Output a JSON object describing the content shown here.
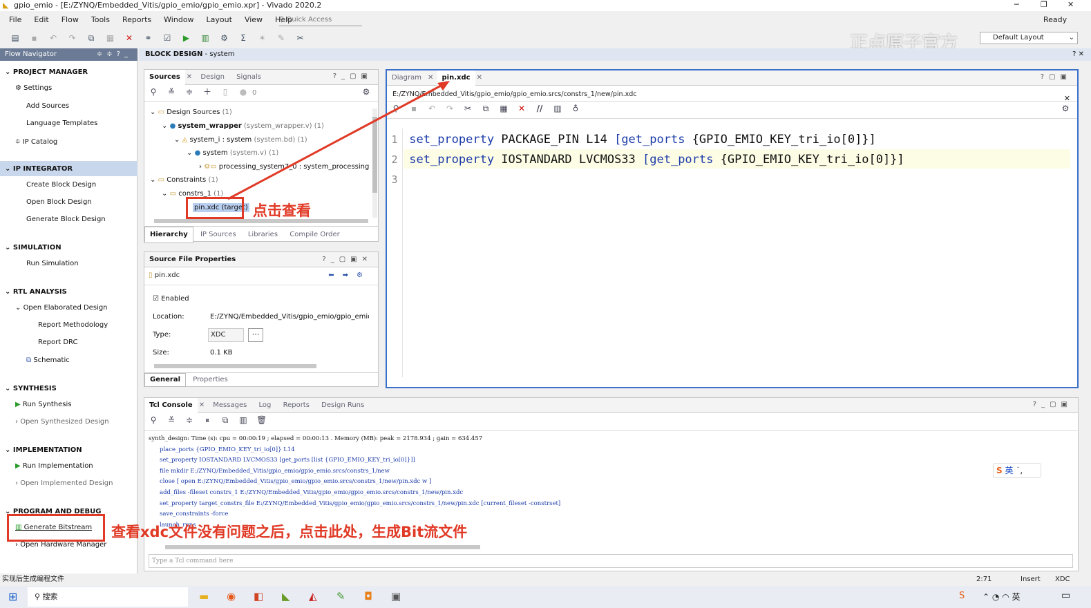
{
  "app": {
    "title": "gpio_emio - [E:/ZYNQ/Embedded_Vitis/gpio_emio/gpio_emio.xpr] - Vivado 2020.2",
    "status_ready": "Ready",
    "watermark": "正点原子官方",
    "layout_select": "Default Layout"
  },
  "menu": [
    "File",
    "Edit",
    "Flow",
    "Tools",
    "Reports",
    "Window",
    "Layout",
    "View",
    "Help"
  ],
  "quick_access_placeholder": "Quick Access",
  "flow_navigator": {
    "title": "Flow Navigator",
    "project_manager": "PROJECT MANAGER",
    "settings": "Settings",
    "add_sources": "Add Sources",
    "language_templates": "Language Templates",
    "ip_catalog": "IP Catalog",
    "ip_integrator": "IP INTEGRATOR",
    "create_block": "Create Block Design",
    "open_block": "Open Block Design",
    "generate_block": "Generate Block Design",
    "simulation": "SIMULATION",
    "run_sim": "Run Simulation",
    "rtl": "RTL ANALYSIS",
    "open_elab": "Open Elaborated Design",
    "report_meth": "Report Methodology",
    "report_drc": "Report DRC",
    "schematic": "Schematic",
    "synthesis": "SYNTHESIS",
    "run_synth": "Run Synthesis",
    "open_synth": "Open Synthesized Design",
    "implementation": "IMPLEMENTATION",
    "run_impl": "Run Implementation",
    "open_impl": "Open Implemented Design",
    "program_debug": "PROGRAM AND DEBUG",
    "gen_bitstream": "Generate Bitstream",
    "open_hw": "Open Hardware Manager"
  },
  "block_design": {
    "label": "BLOCK DESIGN",
    "name": "- system"
  },
  "sources": {
    "tabs": [
      "Sources",
      "Design",
      "Signals"
    ],
    "count": "0",
    "design_sources": "Design Sources",
    "design_sources_count": "(1)",
    "wrapper": "system_wrapper",
    "wrapper_detail": "(system_wrapper.v) (1)",
    "system_i": "system_i : system",
    "system_i_detail": "(system.bd) (1)",
    "system": "system",
    "system_detail": "(system.v) (1)",
    "processing": "processing_system7_0 : system_processing_s",
    "constraints": "Constraints",
    "constraints_count": "(1)",
    "constrs": "constrs_1",
    "constrs_count": "(1)",
    "pin_xdc": "pin.xdc (target)",
    "bottom_tabs": [
      "Hierarchy",
      "IP Sources",
      "Libraries",
      "Compile Order"
    ]
  },
  "props": {
    "title": "Source File Properties",
    "file": "pin.xdc",
    "enabled": "Enabled",
    "location_label": "Location:",
    "location": "E:/ZYNQ/Embedded_Vitis/gpio_emio/gpio_emio.src",
    "type_label": "Type:",
    "type": "XDC",
    "size_label": "Size:",
    "size": "0.1 KB",
    "tabs": [
      "General",
      "Properties"
    ]
  },
  "editor": {
    "tabs": [
      "Diagram",
      "pin.xdc"
    ],
    "path": "E:/ZYNQ/Embedded_Vitis/gpio_emio/gpio_emio.srcs/constrs_1/new/pin.xdc",
    "lines": [
      {
        "n": "1",
        "a": "set_property",
        "b": " PACKAGE_PIN L14 ",
        "c": "[get_ports",
        "d": " {GPIO_EMIO_KEY_tri_io[0]}]"
      },
      {
        "n": "2",
        "a": "set_property",
        "b": " IOSTANDARD LVCMOS33 ",
        "c": "[get_ports",
        "d": " {GPIO_EMIO_KEY_tri_io[0]}]"
      },
      {
        "n": "3",
        "a": "",
        "b": "",
        "c": "",
        "d": ""
      }
    ]
  },
  "console": {
    "tabs": [
      "Tcl Console",
      "Messages",
      "Log",
      "Reports",
      "Design Runs"
    ],
    "lines": [
      "synth_design: Time (s): cpu = 00:00:19 ; elapsed = 00:00:13 . Memory (MB): peak = 2178.934 ; gain = 634.457",
      "place_ports {GPIO_EMIO_KEY_tri_io[0]} L14",
      "set_property IOSTANDARD LVCMOS33 [get_ports [list {GPIO_EMIO_KEY_tri_io[0]}]]",
      "file mkdir E:/ZYNQ/Embedded_Vitis/gpio_emio/gpio_emio.srcs/constrs_1/new",
      "close [ open E:/ZYNQ/Embedded_Vitis/gpio_emio/gpio_emio.srcs/constrs_1/new/pin.xdc w ]",
      "add_files -fileset constrs_1 E:/ZYNQ/Embedded_Vitis/gpio_emio/gpio_emio.srcs/constrs_1/new/pin.xdc",
      "set_property target_constrs_file E:/ZYNQ/Embedded_Vitis/gpio_emio/gpio_emio.srcs/constrs_1/new/pin.xdc [current_fileset -constrset]",
      "save_constraints -force",
      "launch_runs"
    ],
    "placeholder": "Type a Tcl command here",
    "ime": "英"
  },
  "annotations": {
    "click_view": "点击查看",
    "generate_note": "查看xdc文件没有问题之后，点击此处，生成Bit流文件"
  },
  "status_bar": {
    "left": "实现后生成编程文件",
    "pos": "2:71",
    "mode": "Insert",
    "type": "XDC"
  },
  "taskbar": {
    "search": "搜索"
  }
}
